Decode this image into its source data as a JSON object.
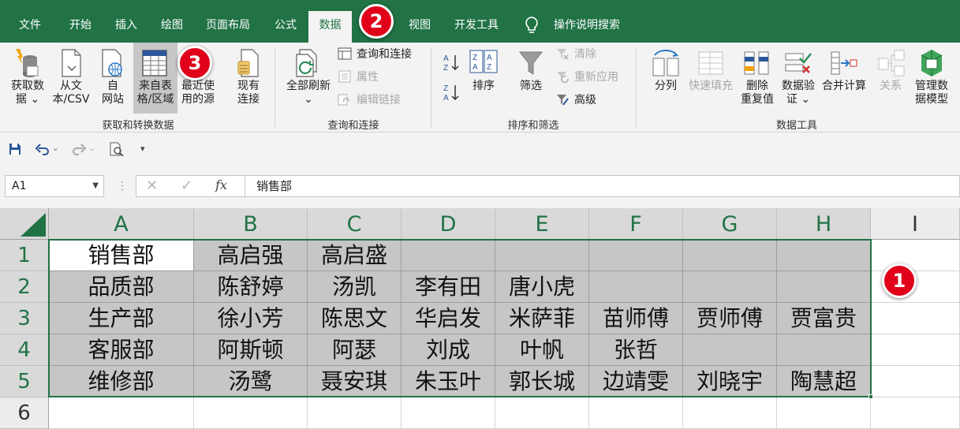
{
  "tabs": [
    {
      "label": "文件",
      "active": false
    },
    {
      "label": "开始",
      "active": false
    },
    {
      "label": "插入",
      "active": false
    },
    {
      "label": "绘图",
      "active": false
    },
    {
      "label": "页面布局",
      "active": false
    },
    {
      "label": "公式",
      "active": false
    },
    {
      "label": "数据",
      "active": true
    },
    {
      "label": "视图",
      "active": false
    },
    {
      "label": "开发工具",
      "active": false
    }
  ],
  "tell_me": {
    "label": "操作说明搜索",
    "icon": "lightbulb-icon"
  },
  "ribbon": {
    "get_transform": {
      "group_label": "获取和转换数据",
      "get_data": {
        "line1": "获取数",
        "line2": "据 ⌄",
        "icon": "database-icon"
      },
      "from_text": {
        "line1": "从文",
        "line2": "本/CSV",
        "icon": "text-file-icon"
      },
      "from_web": {
        "line1": "自",
        "line2": "网站",
        "icon": "web-icon"
      },
      "from_table": {
        "line1": "来自表",
        "line2": "格/区域",
        "icon": "table-icon"
      },
      "recent": {
        "line1": "最近使",
        "line2": "用的源",
        "icon": "recent-sources-icon"
      },
      "existing": {
        "line1": "现有",
        "line2": "连接",
        "icon": "existing-connections-icon"
      }
    },
    "queries": {
      "group_label": "查询和连接",
      "refresh_all": {
        "line1": "全部刷新",
        "line2": "⌄",
        "icon": "refresh-icon"
      },
      "queries_connections": "查询和连接",
      "properties": "属性",
      "edit_links": "编辑链接"
    },
    "sort_filter": {
      "group_label": "排序和筛选",
      "sort": "排序",
      "filter": "筛选",
      "clear": "清除",
      "reapply": "重新应用",
      "advanced": "高级"
    },
    "data_tools": {
      "group_label": "数据工具",
      "text_to_columns": {
        "line1": "分列",
        "line2": ""
      },
      "flash_fill": {
        "line1": "快速填充",
        "line2": ""
      },
      "remove_duplicates": {
        "line1": "删除",
        "line2": "重复值"
      },
      "data_validation": {
        "line1": "数据验",
        "line2": "证 ⌄"
      },
      "consolidate": {
        "line1": "合并计算",
        "line2": ""
      },
      "relationships": {
        "line1": "关系",
        "line2": ""
      },
      "data_model": {
        "line1": "管理数",
        "line2": "据模型"
      }
    }
  },
  "qat": {
    "items": [
      "save-icon",
      "undo-icon",
      "redo-icon",
      "print-preview-icon",
      "customize-icon"
    ]
  },
  "formula_bar": {
    "name_box": "A1",
    "fx": "fx",
    "content": "销售部"
  },
  "sheet": {
    "columns": [
      "A",
      "B",
      "C",
      "D",
      "E",
      "F",
      "G",
      "H",
      "I"
    ],
    "rows": [
      "1",
      "2",
      "3",
      "4",
      "5",
      "6"
    ],
    "cells": [
      [
        "销售部",
        "高启强",
        "高启盛",
        "",
        "",
        "",
        "",
        "",
        ""
      ],
      [
        "品质部",
        "陈舒婷",
        "汤凯",
        "李有田",
        "唐小虎",
        "",
        "",
        "",
        ""
      ],
      [
        "生产部",
        "徐小芳",
        "陈思文",
        "华启发",
        "米萨菲",
        "苗师傅",
        "贾师傅",
        "贾富贵",
        ""
      ],
      [
        "客服部",
        "阿斯顿",
        "阿瑟",
        "刘成",
        "叶帆",
        "张哲",
        "",
        "",
        ""
      ],
      [
        "维修部",
        "汤鹭",
        "聂安琪",
        "朱玉叶",
        "郭长城",
        "边靖雯",
        "刘晓宇",
        "陶慧超",
        ""
      ],
      [
        "",
        "",
        "",
        "",
        "",
        "",
        "",
        "",
        ""
      ]
    ]
  },
  "badges": {
    "one": "1",
    "two": "2",
    "three": "3"
  },
  "colors": {
    "accent": "#217346",
    "badge": "#e0001a",
    "selection": "#c6c6c6"
  }
}
